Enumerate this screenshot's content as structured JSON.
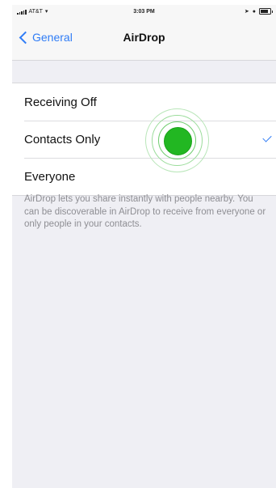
{
  "status_bar": {
    "carrier": "AT&T",
    "time": "3:03 PM"
  },
  "nav": {
    "back_label": "General",
    "title": "AirDrop"
  },
  "options": [
    {
      "label": "Receiving Off",
      "selected": false
    },
    {
      "label": "Contacts Only",
      "selected": true
    },
    {
      "label": "Everyone",
      "selected": false
    }
  ],
  "footer": "AirDrop lets you share instantly with people nearby. You can be discoverable in AirDrop to receive from everyone or only people in your contacts.",
  "colors": {
    "accent": "#2f7cf6",
    "tap_indicator": "#22b722",
    "background": "#efeff4"
  }
}
